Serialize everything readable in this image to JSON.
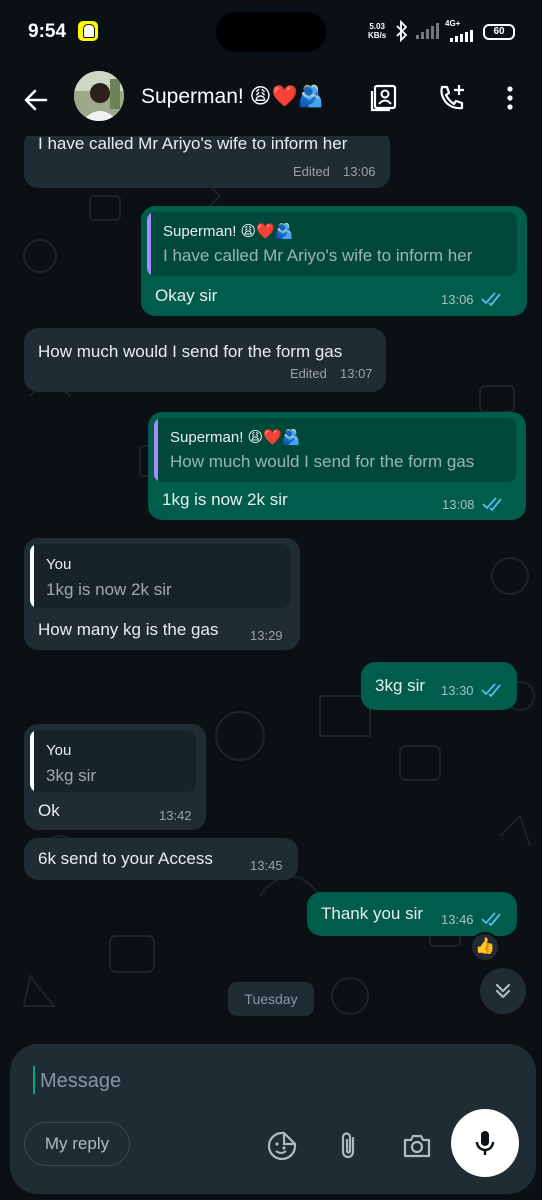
{
  "status_bar": {
    "time": "9:54",
    "net_speed_value": "5.03",
    "net_speed_unit": "KB/s",
    "network": "4G+",
    "battery": "60"
  },
  "header": {
    "contact_name": "Superman! 😩❤️🫂"
  },
  "messages": [
    {
      "id": "m1",
      "direction": "in",
      "text": "I have called Mr Ariyo's wife to inform her",
      "edited": "Edited",
      "time": "13:06"
    },
    {
      "id": "m2",
      "direction": "out",
      "quote_author": "Superman! 😩❤️🫂",
      "quote_text": "I have called Mr Ariyo's wife to inform her",
      "text": "Okay sir",
      "time": "13:06"
    },
    {
      "id": "m3",
      "direction": "in",
      "text": "How much would I send for the form gas",
      "edited": "Edited",
      "time": "13:07"
    },
    {
      "id": "m4",
      "direction": "out",
      "quote_author": "Superman! 😩❤️🫂",
      "quote_text": "How much would I send for the form gas",
      "text": "1kg is now 2k sir",
      "time": "13:08"
    },
    {
      "id": "m5",
      "direction": "in",
      "quote_author": "You",
      "quote_text": "1kg is now 2k sir",
      "text": "How many kg is the gas",
      "time": "13:29"
    },
    {
      "id": "m6",
      "direction": "out",
      "text": "3kg sir",
      "time": "13:30"
    },
    {
      "id": "m7",
      "direction": "in",
      "quote_author": "You",
      "quote_text": "3kg sir",
      "text": "Ok",
      "time": "13:42"
    },
    {
      "id": "m8",
      "direction": "in",
      "text": "6k send to your Access",
      "time": "13:45"
    },
    {
      "id": "m9",
      "direction": "out",
      "text": "Thank you sir",
      "time": "13:46",
      "reaction": "👍"
    }
  ],
  "day_separator": "Tuesday",
  "composer": {
    "placeholder": "Message",
    "reply_chip": "My reply"
  },
  "colors": {
    "background": "#0b1014",
    "incoming_bubble": "#1f2c34",
    "outgoing_bubble": "#005c4b",
    "read_ticks": "#53bdeb",
    "quote_bar_contact": "#a78bfa",
    "quote_bar_you": "#ffffff"
  },
  "icons": {
    "back": "arrow-left-icon",
    "contact_card": "contact-card-icon",
    "add_call": "phone-plus-icon",
    "more": "kebab-menu-icon",
    "scroll_down": "double-chevron-down-icon",
    "sticker": "sticker-icon",
    "attach": "paperclip-icon",
    "camera": "camera-icon",
    "mic": "mic-icon"
  }
}
